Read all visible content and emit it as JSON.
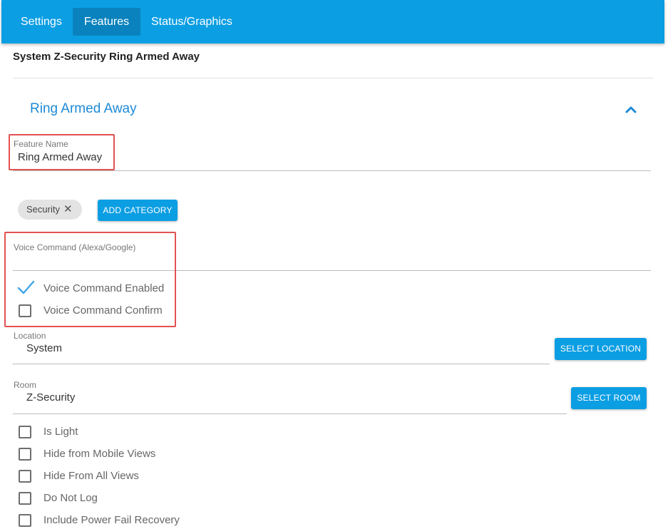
{
  "tabs": [
    {
      "label": "Settings",
      "active": false
    },
    {
      "label": "Features",
      "active": true
    },
    {
      "label": "Status/Graphics",
      "active": false
    }
  ],
  "page_title": "System Z-Security Ring Armed Away",
  "section": {
    "title": "Ring Armed Away",
    "expanded": true
  },
  "feature_name": {
    "label": "Feature Name",
    "value": "Ring Armed Away"
  },
  "categories": {
    "chips": [
      "Security"
    ],
    "add_button": "ADD CATEGORY"
  },
  "voice_command": {
    "label": "Voice Command (Alexa/Google)",
    "value": ""
  },
  "voice_options": [
    {
      "label": "Voice Command Enabled",
      "checked": true
    },
    {
      "label": "Voice Command Confirm",
      "checked": false
    }
  ],
  "location": {
    "label": "Location",
    "value": "System",
    "button": "SELECT LOCATION"
  },
  "room": {
    "label": "Room",
    "value": "Z-Security",
    "button": "SELECT ROOM"
  },
  "options": [
    {
      "label": "Is Light",
      "checked": false
    },
    {
      "label": "Hide from Mobile Views",
      "checked": false
    },
    {
      "label": "Hide From All Views",
      "checked": false
    },
    {
      "label": "Do Not Log",
      "checked": false
    },
    {
      "label": "Include Power Fail Recovery",
      "checked": false
    }
  ],
  "colors": {
    "accent": "#0b9ee3",
    "accent_dark": "#0a82bd",
    "link_blue": "#1e8ad6",
    "highlight_red": "#e35152",
    "check_blue": "#3ea5e6"
  }
}
